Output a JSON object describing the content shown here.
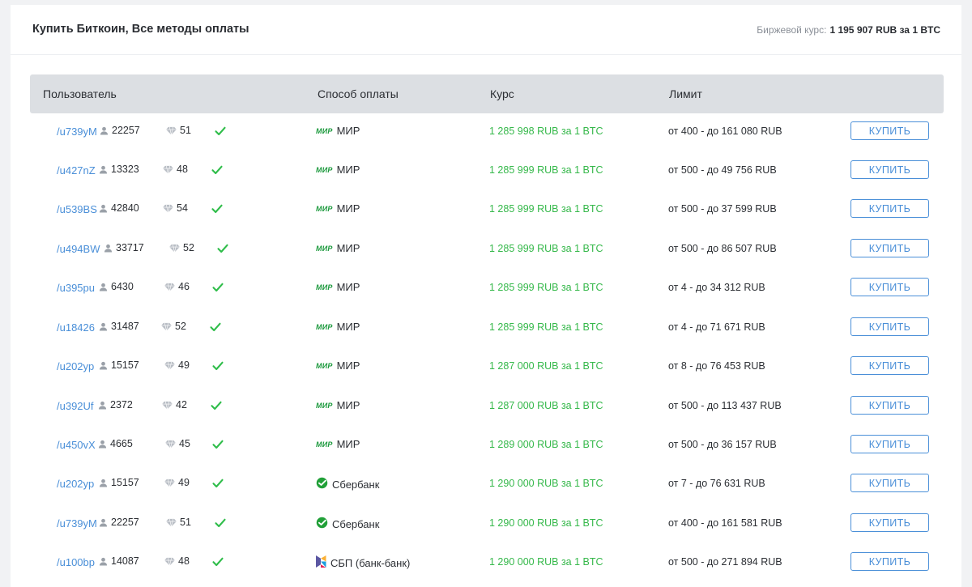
{
  "header": {
    "title": "Купить Биткоин, Все методы оплаты",
    "exchange_label": "Биржевой курс:",
    "exchange_value": "1 195 907 RUB за 1 BTC"
  },
  "columns": [
    "Пользователь",
    "Способ оплаты",
    "Курс",
    "Лимит"
  ],
  "buy_label": "КУПИТЬ",
  "colors": {
    "link": "#4a8fd8",
    "rate": "#35b84a",
    "check": "#2fbd4a",
    "header_bg": "#dcdfe3"
  },
  "offers": [
    {
      "user": "/u739yM",
      "deals": "22257",
      "rating": "51",
      "payment": "МИР",
      "payment_icon": "mir-logo",
      "rate": "1 285 998 RUB за 1 BTC",
      "limit": "от 400 - до 161 080 RUB"
    },
    {
      "user": "/u427nZ",
      "deals": "13323",
      "rating": "48",
      "payment": "МИР",
      "payment_icon": "mir-logo",
      "rate": "1 285 999 RUB за 1 BTC",
      "limit": "от 500 - до 49 756 RUB"
    },
    {
      "user": "/u539BS",
      "deals": "42840",
      "rating": "54",
      "payment": "МИР",
      "payment_icon": "mir-logo",
      "rate": "1 285 999 RUB за 1 BTC",
      "limit": "от 500 - до 37 599 RUB"
    },
    {
      "user": "/u494BW",
      "deals": "33717",
      "rating": "52",
      "payment": "МИР",
      "payment_icon": "mir-logo",
      "rate": "1 285 999 RUB за 1 BTC",
      "limit": "от 500 - до 86 507 RUB"
    },
    {
      "user": "/u395pu",
      "deals": "6430",
      "rating": "46",
      "payment": "МИР",
      "payment_icon": "mir-logo",
      "rate": "1 285 999 RUB за 1 BTC",
      "limit": "от 4 - до 34 312 RUB"
    },
    {
      "user": "/u18426",
      "deals": "31487",
      "rating": "52",
      "payment": "МИР",
      "payment_icon": "mir-logo",
      "rate": "1 285 999 RUB за 1 BTC",
      "limit": "от 4 - до 71 671 RUB"
    },
    {
      "user": "/u202yp",
      "deals": "15157",
      "rating": "49",
      "payment": "МИР",
      "payment_icon": "mir-logo",
      "rate": "1 287 000 RUB за 1 BTC",
      "limit": "от 8 - до 76 453 RUB"
    },
    {
      "user": "/u392Uf",
      "deals": "2372",
      "rating": "42",
      "payment": "МИР",
      "payment_icon": "mir-logo",
      "rate": "1 287 000 RUB за 1 BTC",
      "limit": "от 500 - до 113 437 RUB"
    },
    {
      "user": "/u450vX",
      "deals": "4665",
      "rating": "45",
      "payment": "МИР",
      "payment_icon": "mir-logo",
      "rate": "1 289 000 RUB за 1 BTC",
      "limit": "от 500 - до 36 157 RUB"
    },
    {
      "user": "/u202yp",
      "deals": "15157",
      "rating": "49",
      "payment": "Сбербанк",
      "payment_icon": "sberbank-icon",
      "rate": "1 290 000 RUB за 1 BTC",
      "limit": "от 7 - до 76 631 RUB"
    },
    {
      "user": "/u739yM",
      "deals": "22257",
      "rating": "51",
      "payment": "Сбербанк",
      "payment_icon": "sberbank-icon",
      "rate": "1 290 000 RUB за 1 BTC",
      "limit": "от 400 - до 161 581 RUB"
    },
    {
      "user": "/u100bp",
      "deals": "14087",
      "rating": "48",
      "payment": "СБП (банк-банк)",
      "payment_icon": "sbp-icon",
      "rate": "1 290 000 RUB за 1 BTC",
      "limit": "от 500 - до 271 894 RUB"
    }
  ]
}
